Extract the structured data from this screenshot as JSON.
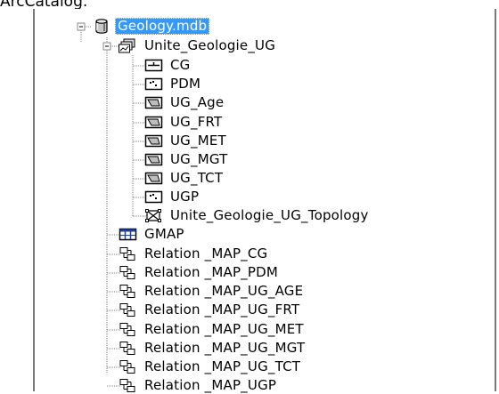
{
  "top_text": "ArcCatalog.",
  "tree": {
    "root": {
      "label": "Geology.mdb",
      "icon": "database-icon",
      "expanded": true,
      "selected": true
    },
    "dataset": {
      "label": "Unite_Geologie_UG",
      "icon": "feature-dataset-icon",
      "expanded": true
    },
    "dataset_children": [
      {
        "label": "CG",
        "icon": "line-feature-class-icon"
      },
      {
        "label": "PDM",
        "icon": "point-feature-class-icon"
      },
      {
        "label": "UG_Age",
        "icon": "polygon-feature-class-icon"
      },
      {
        "label": "UG_FRT",
        "icon": "polygon-feature-class-icon"
      },
      {
        "label": "UG_MET",
        "icon": "polygon-feature-class-icon"
      },
      {
        "label": "UG_MGT",
        "icon": "polygon-feature-class-icon"
      },
      {
        "label": "UG_TCT",
        "icon": "polygon-feature-class-icon"
      },
      {
        "label": "UGP",
        "icon": "point-feature-class-icon"
      },
      {
        "label": "Unite_Geologie_UG_Topology",
        "icon": "topology-icon"
      }
    ],
    "root_children": [
      {
        "label": "GMAP",
        "icon": "table-icon"
      },
      {
        "label": "Relation _MAP_CG",
        "icon": "relationship-class-icon"
      },
      {
        "label": "Relation _MAP_PDM",
        "icon": "relationship-class-icon"
      },
      {
        "label": "Relation _MAP_UG_AGE",
        "icon": "relationship-class-icon"
      },
      {
        "label": "Relation _MAP_UG_FRT",
        "icon": "relationship-class-icon"
      },
      {
        "label": "Relation _MAP_UG_MET",
        "icon": "relationship-class-icon"
      },
      {
        "label": "Relation _MAP_UG_MGT",
        "icon": "relationship-class-icon"
      },
      {
        "label": "Relation _MAP_UG_TCT",
        "icon": "relationship-class-icon"
      },
      {
        "label": "Relation _MAP_UGP",
        "icon": "relationship-class-icon"
      }
    ]
  }
}
